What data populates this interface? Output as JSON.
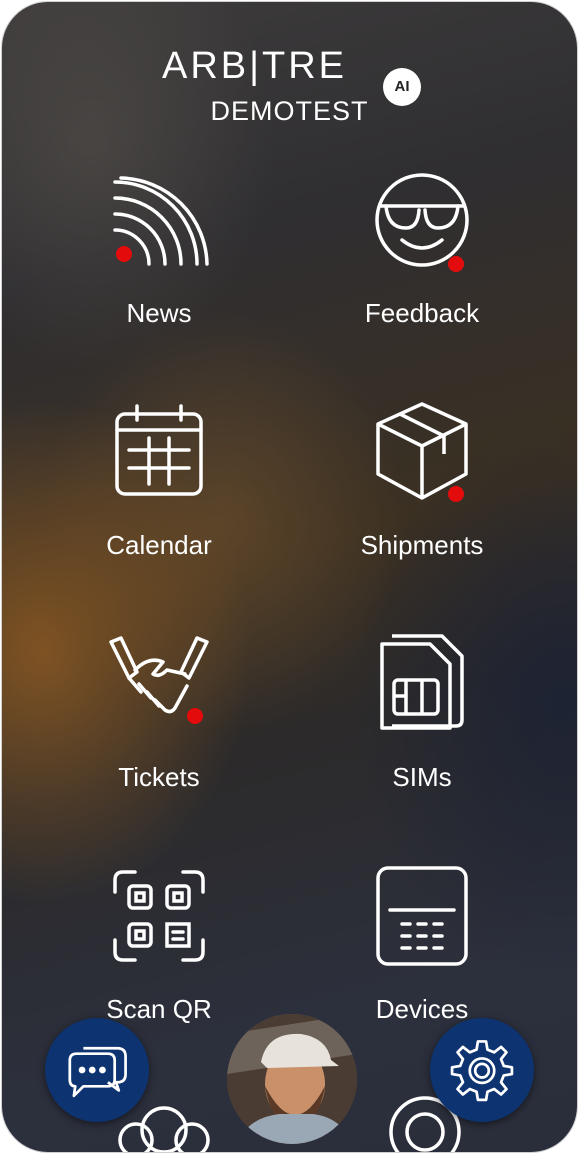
{
  "header": {
    "brand": "ARB|TRE",
    "brand_badge": "AI",
    "subtitle": "DEMOTEST"
  },
  "tiles": [
    {
      "label": "News",
      "icon": "rss-icon",
      "notification": true
    },
    {
      "label": "Feedback",
      "icon": "sunglasses-smiley-icon",
      "notification": true
    },
    {
      "label": "Calendar",
      "icon": "calendar-icon",
      "notification": false
    },
    {
      "label": "Shipments",
      "icon": "package-box-icon",
      "notification": true
    },
    {
      "label": "Tickets",
      "icon": "handshake-icon",
      "notification": true
    },
    {
      "label": "SIMs",
      "icon": "sim-card-icon",
      "notification": false
    },
    {
      "label": "Scan QR",
      "icon": "qr-scan-icon",
      "notification": false
    },
    {
      "label": "Devices",
      "icon": "device-keypad-icon",
      "notification": false
    }
  ],
  "bottom_bar": {
    "left_button_icon": "chat-bubbles-icon",
    "center_avatar": "user-avatar",
    "right_button_icon": "gear-icon"
  },
  "colors": {
    "notification_dot": "#e30b0b",
    "fab": "#0d3470"
  }
}
